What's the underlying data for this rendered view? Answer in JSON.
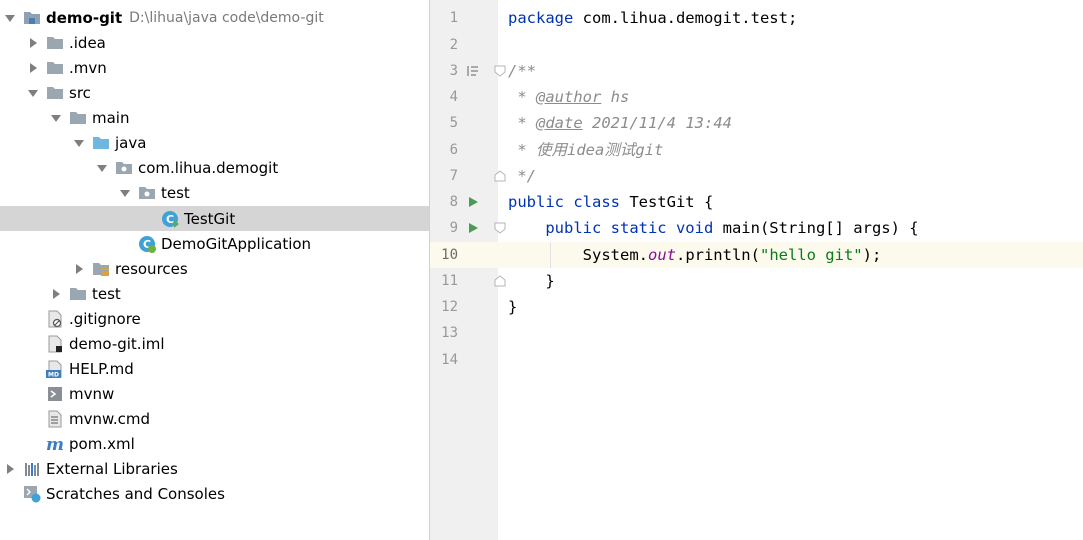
{
  "project_tree": {
    "rows": [
      {
        "label": "demo-git",
        "path": "D:\\lihua\\java code\\demo-git",
        "icon": "module-folder-icon"
      },
      {
        "label": ".idea",
        "icon": "folder-icon"
      },
      {
        "label": ".mvn",
        "icon": "folder-icon"
      },
      {
        "label": "src",
        "icon": "folder-icon"
      },
      {
        "label": "main",
        "icon": "folder-icon"
      },
      {
        "label": "java",
        "icon": "source-root-folder-icon"
      },
      {
        "label": "com.lihua.demogit",
        "icon": "package-icon"
      },
      {
        "label": "test",
        "icon": "package-icon"
      },
      {
        "label": "TestGit",
        "icon": "java-class-icon"
      },
      {
        "label": "DemoGitApplication",
        "icon": "spring-boot-class-icon"
      },
      {
        "label": "resources",
        "icon": "resources-folder-icon"
      },
      {
        "label": "test",
        "icon": "folder-icon"
      },
      {
        "label": ".gitignore",
        "icon": "ignore-file-icon"
      },
      {
        "label": "demo-git.iml",
        "icon": "iml-file-icon"
      },
      {
        "label": "HELP.md",
        "icon": "markdown-file-icon"
      },
      {
        "label": "mvnw",
        "icon": "shell-script-icon"
      },
      {
        "label": "mvnw.cmd",
        "icon": "text-file-icon"
      },
      {
        "label": "pom.xml",
        "icon": "maven-icon"
      },
      {
        "label": "External Libraries",
        "icon": "libraries-icon"
      },
      {
        "label": "Scratches and Consoles",
        "icon": "scratches-icon"
      }
    ],
    "selected": "TestGit"
  },
  "editor": {
    "line_numbers": [
      "1",
      "2",
      "3",
      "4",
      "5",
      "6",
      "7",
      "8",
      "9",
      "10",
      "11",
      "12",
      "13",
      "14"
    ],
    "current_line": "10",
    "code": {
      "l1_kw": "package",
      "l1_rest": " com.lihua.demogit.test;",
      "l3": "/**",
      "l4_a": " * ",
      "l4_tag": "@author",
      "l4_b": " hs",
      "l5_a": " * ",
      "l5_tag": "@date",
      "l5_b": " 2021/11/4 13:44",
      "l6": " * 使用idea测试git",
      "l7": " */",
      "l8_kw": "public class",
      "l8_rest": " TestGit {",
      "l9_indent": "    ",
      "l9_kw": "public static void",
      "l9_rest": " main(String[] args) {",
      "l10_a": "        System.",
      "l10_field": "out",
      "l10_b": ".println(",
      "l10_str": "\"hello git\"",
      "l10_c": ");",
      "l11": "    }",
      "l12": "}"
    }
  },
  "colors": {
    "keyword": "#0033b3",
    "comment": "#8c8c8c",
    "string": "#067d17",
    "field": "#871094",
    "selection": "#d5d5d5",
    "current_line": "#fcfaed"
  }
}
